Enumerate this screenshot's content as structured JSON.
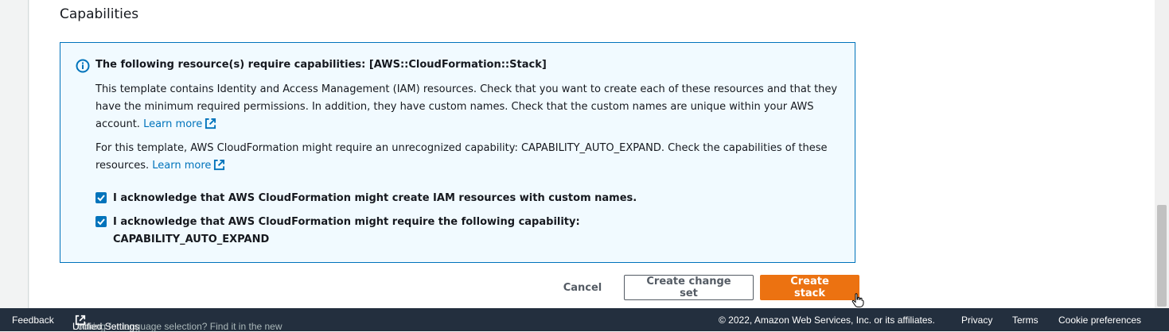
{
  "section": {
    "title": "Capabilities"
  },
  "alert": {
    "header": "The following resource(s) require capabilities: [AWS::CloudFormation::Stack]",
    "paragraph1": "This template contains Identity and Access Management (IAM) resources. Check that you want to create each of these resources and that they have the minimum required permissions. In addition, they have custom names. Check that the custom names are unique within your AWS account.",
    "paragraph1_link": "Learn more",
    "paragraph2": "For this template, AWS CloudFormation might require an unrecognized capability: CAPABILITY_AUTO_EXPAND. Check the capabilities of these resources.",
    "paragraph2_link": "Learn more",
    "icon": "info-icon",
    "border_color": "#0073bb",
    "background_color": "#f1faff"
  },
  "acknowledgements": [
    {
      "line1": "I acknowledge that AWS CloudFormation might create IAM resources with custom names.",
      "line2": "",
      "checked": true
    },
    {
      "line1": "I acknowledge that AWS CloudFormation might require the following capability:",
      "line2": "CAPABILITY_AUTO_EXPAND",
      "checked": true
    }
  ],
  "actions": {
    "cancel": "Cancel",
    "create_change_set": "Create change set",
    "create_stack": "Create stack",
    "primary_color": "#ec7211"
  },
  "footer": {
    "feedback": "Feedback",
    "language_prompt": "Looking for language selection? Find it in the new",
    "unified_settings": "Unified Settings",
    "copyright": "© 2022, Amazon Web Services, Inc. or its affiliates.",
    "privacy": "Privacy",
    "terms": "Terms",
    "cookie_preferences": "Cookie preferences",
    "background_color": "#232f3e"
  }
}
